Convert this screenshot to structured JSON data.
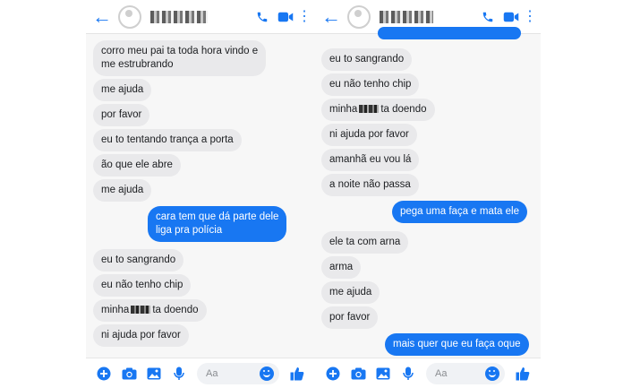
{
  "left_chat": {
    "header": {
      "back_icon": "back-arrow-icon",
      "phone_icon": "phone-icon",
      "video_icon": "video-icon",
      "menu_icon": "more-vertical-icon"
    },
    "messages": [
      {
        "dir": "in",
        "lines": [
          "corro meu pai ta toda hora vindo e",
          "me estrubrando"
        ]
      },
      {
        "dir": "in",
        "text": "me ajuda"
      },
      {
        "dir": "in",
        "text": "por favor"
      },
      {
        "dir": "in",
        "text": "eu to tentando trança a porta"
      },
      {
        "dir": "in",
        "text": "ão que ele abre"
      },
      {
        "dir": "in",
        "text": "me ajuda"
      },
      {
        "dir": "out",
        "lines": [
          "cara tem que dá parte  dele",
          "liga pra polícia"
        ]
      },
      {
        "dir": "in",
        "text": "eu to sangrando"
      },
      {
        "dir": "in",
        "text": "eu não tenho chip"
      },
      {
        "dir": "in",
        "prefix": "minha",
        "suffix": "ta doendo"
      },
      {
        "dir": "in",
        "text": "ni ajuda por favor"
      }
    ],
    "composer": {
      "placeholder": "Aa"
    }
  },
  "right_chat": {
    "messages": [
      {
        "dir": "in",
        "text": "eu to sangrando"
      },
      {
        "dir": "in",
        "text": "eu não tenho chip"
      },
      {
        "dir": "in",
        "prefix": "minha",
        "suffix": "ta doendo"
      },
      {
        "dir": "in",
        "text": "ni ajuda por favor"
      },
      {
        "dir": "in",
        "text": "amanhã eu vou lá"
      },
      {
        "dir": "in",
        "text": "a noite não passa"
      },
      {
        "dir": "out",
        "text": "pega uma faça e mata ele"
      },
      {
        "dir": "in",
        "text": "ele ta com arna"
      },
      {
        "dir": "in",
        "text": "arma"
      },
      {
        "dir": "in",
        "text": "me ajuda"
      },
      {
        "dir": "in",
        "text": "por favor"
      },
      {
        "dir": "out",
        "text": "mais quer que eu faça oque"
      }
    ],
    "composer": {
      "placeholder": "Aa"
    }
  },
  "colors": {
    "accent": "#1877f2",
    "incoming_bubble": "#e9e9eb"
  }
}
